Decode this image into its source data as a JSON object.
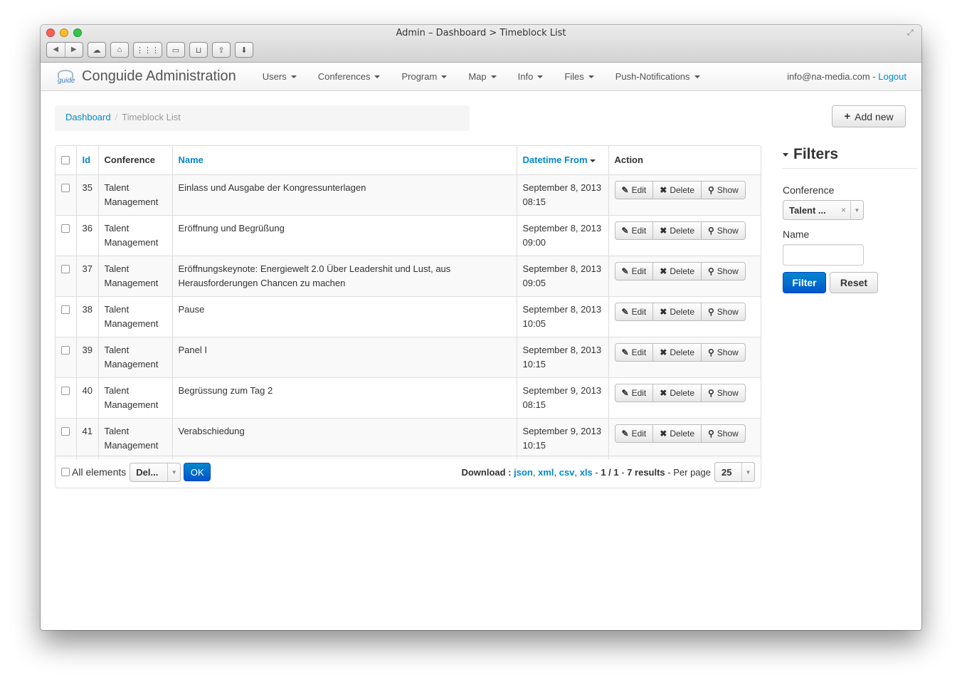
{
  "window": {
    "title": "Admin – Dashboard > Timeblock List"
  },
  "navbar": {
    "brand": "Conguide Administration",
    "logo_text": "guide",
    "menu": [
      {
        "label": "Users"
      },
      {
        "label": "Conferences"
      },
      {
        "label": "Program"
      },
      {
        "label": "Map"
      },
      {
        "label": "Info"
      },
      {
        "label": "Files"
      },
      {
        "label": "Push-Notifications"
      }
    ],
    "user_email": "info@na-media.com",
    "separator": " - ",
    "logout": "Logout"
  },
  "breadcrumb": {
    "home": "Dashboard",
    "sep": "/",
    "current": "Timeblock List"
  },
  "add_new": "Add new",
  "table": {
    "headers": {
      "id": "Id",
      "conference": "Conference",
      "name": "Name",
      "datetime": "Datetime From",
      "action": "Action"
    },
    "actions": {
      "edit": "Edit",
      "delete": "Delete",
      "show": "Show"
    },
    "rows": [
      {
        "id": "35",
        "conference": "Talent Management",
        "name": "Einlass und Ausgabe der Kongressunterlagen",
        "date": "September 8, 2013",
        "time": "08:15"
      },
      {
        "id": "36",
        "conference": "Talent Management",
        "name": "Eröffnung und Begrüßung",
        "date": "September 8, 2013",
        "time": "09:00"
      },
      {
        "id": "37",
        "conference": "Talent Management",
        "name": "Eröffnungskeynote: Energiewelt 2.0 Über Leadershit und Lust, aus Herausforderungen Chancen zu machen",
        "date": "September 8, 2013",
        "time": "09:05"
      },
      {
        "id": "38",
        "conference": "Talent Management",
        "name": "Pause",
        "date": "September 8, 2013",
        "time": "10:05"
      },
      {
        "id": "39",
        "conference": "Talent Management",
        "name": "Panel I",
        "date": "September 8, 2013",
        "time": "10:15"
      },
      {
        "id": "40",
        "conference": "Talent Management",
        "name": "Begrüssung zum Tag 2",
        "date": "September 9, 2013",
        "time": "08:15"
      },
      {
        "id": "41",
        "conference": "Talent Management",
        "name": "Verabschiedung",
        "date": "September 9, 2013",
        "time": "10:15"
      }
    ]
  },
  "footer": {
    "all_elements": "All elements",
    "batch_select": "Del...",
    "ok": "OK",
    "download_label": "Download :",
    "formats": [
      "json",
      "xml",
      "csv",
      "xls"
    ],
    "pagination": "1 / 1",
    "results": "7 results",
    "per_page_label": "Per page",
    "per_page_value": "25"
  },
  "filters": {
    "title": "Filters",
    "conference_label": "Conference",
    "conference_value": "Talent ...",
    "conference_clear": "×",
    "name_label": "Name",
    "name_value": "",
    "filter_button": "Filter",
    "reset_button": "Reset"
  }
}
